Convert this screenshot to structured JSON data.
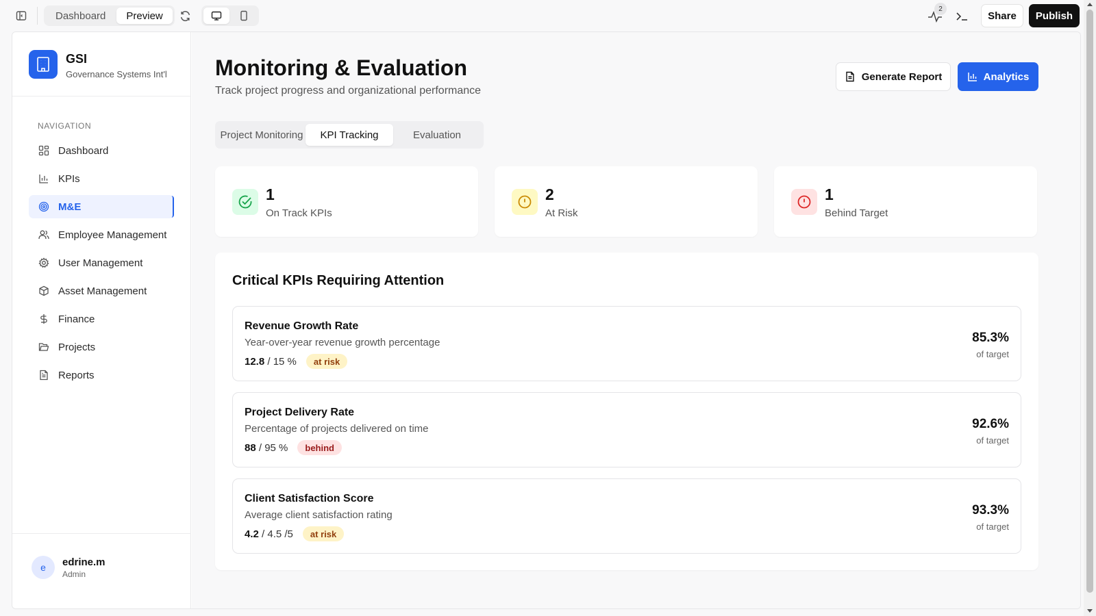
{
  "topbar": {
    "tabs": [
      "Dashboard",
      "Preview"
    ],
    "active_tab": "Preview",
    "notification_count": "2",
    "share_label": "Share",
    "publish_label": "Publish"
  },
  "sidebar": {
    "brand_name": "GSI",
    "brand_sub": "Governance Systems Int'l",
    "nav_heading": "NAVIGATION",
    "items": [
      {
        "label": "Dashboard",
        "icon": "grid-icon"
      },
      {
        "label": "KPIs",
        "icon": "bar-chart-icon"
      },
      {
        "label": "M&E",
        "icon": "target-icon",
        "active": true
      },
      {
        "label": "Employee Management",
        "icon": "users-icon"
      },
      {
        "label": "User Management",
        "icon": "gear-icon"
      },
      {
        "label": "Asset Management",
        "icon": "box-icon"
      },
      {
        "label": "Finance",
        "icon": "dollar-icon"
      },
      {
        "label": "Projects",
        "icon": "folder-icon"
      },
      {
        "label": "Reports",
        "icon": "document-icon"
      }
    ],
    "user": {
      "initial": "e",
      "name": "edrine.m",
      "role": "Admin"
    }
  },
  "main": {
    "title": "Monitoring & Evaluation",
    "subtitle": "Track project progress and organizational performance",
    "generate_report_label": "Generate Report",
    "analytics_label": "Analytics",
    "tabs": [
      "Project Monitoring",
      "KPI Tracking",
      "Evaluation"
    ],
    "active_tab": "KPI Tracking",
    "stats": [
      {
        "value": "1",
        "label": "On Track KPIs",
        "status": "on-track",
        "color": "#16a34a"
      },
      {
        "value": "2",
        "label": "At Risk",
        "status": "at-risk",
        "color": "#ca8a04"
      },
      {
        "value": "1",
        "label": "Behind Target",
        "status": "behind",
        "color": "#dc2626"
      }
    ],
    "critical_title": "Critical KPIs Requiring Attention",
    "kpis": [
      {
        "name": "Revenue Growth Rate",
        "description": "Year-over-year revenue growth percentage",
        "current": "12.8",
        "target": "/ 15 %",
        "status": "at risk",
        "percent": "85.3%",
        "percent_label": "of target"
      },
      {
        "name": "Project Delivery Rate",
        "description": "Percentage of projects delivered on time",
        "current": "88",
        "target": "/ 95 %",
        "status": "behind",
        "percent": "92.6%",
        "percent_label": "of target"
      },
      {
        "name": "Client Satisfaction Score",
        "description": "Average client satisfaction rating",
        "current": "4.2",
        "target": "/ 4.5 /5",
        "status": "at risk",
        "percent": "93.3%",
        "percent_label": "of target"
      }
    ]
  },
  "colors": {
    "accent": "#2563eb",
    "at_risk_bg": "#fef3c7",
    "at_risk_text": "#92400e",
    "behind_bg": "#fee2e2",
    "behind_text": "#991b1b"
  }
}
